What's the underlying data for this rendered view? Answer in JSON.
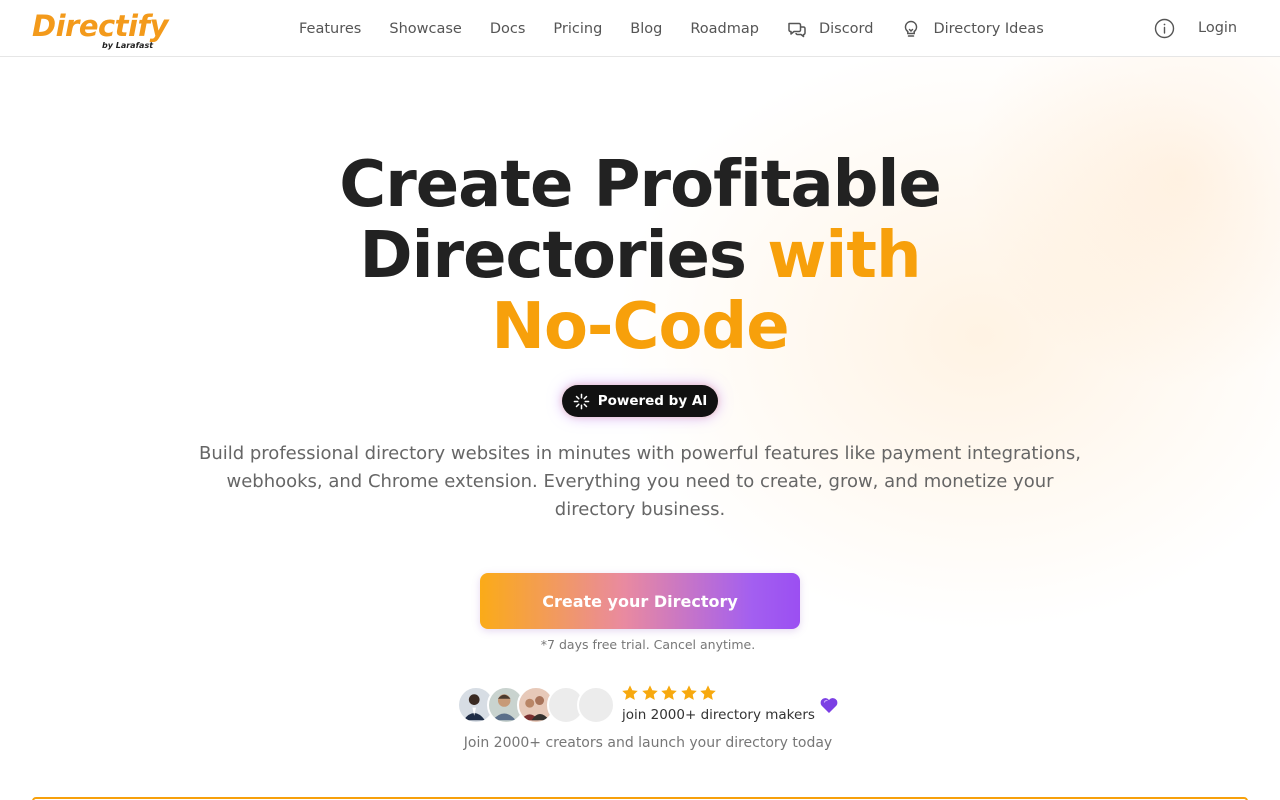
{
  "brand": {
    "name": "Directify",
    "sub": "by Larafast",
    "color": "#f39a1b"
  },
  "nav": {
    "items": [
      {
        "label": "Features"
      },
      {
        "label": "Showcase"
      },
      {
        "label": "Docs"
      },
      {
        "label": "Pricing"
      },
      {
        "label": "Blog"
      },
      {
        "label": "Roadmap"
      },
      {
        "label": "Discord",
        "icon": "chat-bubbles-icon"
      },
      {
        "label": "Directory Ideas",
        "icon": "lightbulb-icon"
      }
    ],
    "info_icon": "info-icon",
    "login": "Login"
  },
  "hero": {
    "title_line1": "Create Profitable",
    "title_line2_dark": "Directories",
    "title_line2_accent": "with",
    "title_line3": "No-Code",
    "accent_color": "#f7a00b",
    "badge": "Powered by AI",
    "description": "Build professional directory websites in minutes with powerful features like payment integrations, webhooks, and Chrome extension. Everything you need to create, grow, and monetize your directory business.",
    "cta": "Create your Directory",
    "trial_note": "*7 days free trial. Cancel anytime.",
    "rating_stars": 5,
    "makers_text": "join 2000+ directory makers",
    "join_text": "Join 2000+ creators and launch your directory today"
  }
}
